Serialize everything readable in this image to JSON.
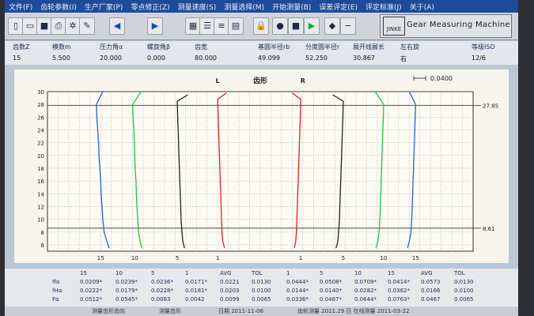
{
  "menu": [
    "文件(F)",
    "齿轮参数(I)",
    "生产厂家(P)",
    "零点修正(Z)",
    "测量速度(S)",
    "测量选择(M)",
    "开始测量(B)",
    "误差评定(E)",
    "评定标准(J)",
    "关于(A)"
  ],
  "toolbar": {
    "icons": [
      "new-file-icon",
      "open-folder-icon",
      "save-icon",
      "print-icon",
      "settings-icon",
      "clear-icon",
      "arrow-left-icon",
      "arrow-right-icon",
      "grid-view-icon",
      "list-view-icon",
      "lines-view-icon",
      "document-icon",
      "lock-icon",
      "record-icon",
      "stop-icon",
      "play-icon",
      "diamond-icon",
      "minus-icon"
    ],
    "brand_text": "Gear Measuring Machine",
    "brand_logo": "JINKE"
  },
  "params": {
    "headers": [
      "齿数Z",
      "模数m",
      "压力角α",
      "螺旋角β",
      "齿宽",
      "基圆半径rb",
      "分度圆半径r",
      "展开线展长",
      "左右旋",
      "等级ISO"
    ],
    "values": [
      "15",
      "5.500",
      "20.000",
      "0.000",
      "80.000",
      "49.099",
      "52.250",
      "30.867",
      "右",
      "12/6"
    ]
  },
  "chart_data": {
    "type": "line",
    "title": "齿形",
    "left_label": "L",
    "right_label": "R",
    "scale_label": "0.0400",
    "y_ticks": [
      30,
      28,
      26,
      24,
      22,
      20,
      18,
      16,
      14,
      12,
      10,
      8,
      6
    ],
    "ylim": [
      5,
      30
    ],
    "xlim": [
      0,
      1
    ],
    "right_markers": [
      "27.85",
      "8.61"
    ],
    "bottom_labels": [
      {
        "text": "15",
        "x": 0.125
      },
      {
        "text": "10",
        "x": 0.205
      },
      {
        "text": "5",
        "x": 0.305
      },
      {
        "text": "1",
        "x": 0.4
      },
      {
        "text": "1",
        "x": 0.595
      },
      {
        "text": "5",
        "x": 0.695
      },
      {
        "text": "10",
        "x": 0.79
      },
      {
        "text": "15",
        "x": 0.865
      }
    ],
    "series": [
      {
        "color": "#2a5fd8",
        "values": [
          [
            0.13,
            30
          ],
          [
            0.115,
            28
          ],
          [
            0.116,
            26
          ],
          [
            0.118,
            24
          ],
          [
            0.12,
            22
          ],
          [
            0.121,
            20
          ],
          [
            0.123,
            18
          ],
          [
            0.125,
            16
          ],
          [
            0.126,
            14
          ],
          [
            0.128,
            12
          ],
          [
            0.13,
            10
          ],
          [
            0.133,
            8
          ],
          [
            0.14,
            6.5
          ],
          [
            0.145,
            5.5
          ]
        ]
      },
      {
        "color": "#22c24a",
        "values": [
          [
            0.22,
            30
          ],
          [
            0.2,
            28
          ],
          [
            0.201,
            26
          ],
          [
            0.203,
            24
          ],
          [
            0.204,
            22
          ],
          [
            0.205,
            20
          ],
          [
            0.206,
            18
          ],
          [
            0.208,
            16
          ],
          [
            0.209,
            14
          ],
          [
            0.21,
            12
          ],
          [
            0.212,
            10
          ],
          [
            0.214,
            8
          ],
          [
            0.218,
            6.5
          ],
          [
            0.222,
            5.5
          ]
        ]
      },
      {
        "color": "#222222",
        "values": [
          [
            0.33,
            29.5
          ],
          [
            0.305,
            28.5
          ],
          [
            0.306,
            26
          ],
          [
            0.307,
            24
          ],
          [
            0.308,
            22
          ],
          [
            0.309,
            20
          ],
          [
            0.31,
            18
          ],
          [
            0.311,
            16
          ],
          [
            0.312,
            14
          ],
          [
            0.313,
            12
          ],
          [
            0.314,
            10
          ],
          [
            0.316,
            8
          ],
          [
            0.318,
            6.5
          ],
          [
            0.322,
            5.5
          ]
        ]
      },
      {
        "color": "#e02020",
        "values": [
          [
            0.42,
            29.8
          ],
          [
            0.4,
            28.8
          ],
          [
            0.401,
            26
          ],
          [
            0.402,
            24
          ],
          [
            0.403,
            22
          ],
          [
            0.404,
            20
          ],
          [
            0.405,
            18
          ],
          [
            0.406,
            16
          ],
          [
            0.407,
            14
          ],
          [
            0.408,
            12
          ],
          [
            0.409,
            10
          ],
          [
            0.41,
            8
          ],
          [
            0.412,
            6.5
          ],
          [
            0.416,
            5.5
          ]
        ]
      },
      {
        "color": "#e02020",
        "values": [
          [
            0.575,
            29.8
          ],
          [
            0.595,
            28.8
          ],
          [
            0.594,
            26
          ],
          [
            0.593,
            24
          ],
          [
            0.592,
            22
          ],
          [
            0.591,
            20
          ],
          [
            0.59,
            18
          ],
          [
            0.589,
            16
          ],
          [
            0.588,
            14
          ],
          [
            0.587,
            12
          ],
          [
            0.586,
            10
          ],
          [
            0.585,
            8
          ],
          [
            0.583,
            6.5
          ],
          [
            0.58,
            5.5
          ]
        ]
      },
      {
        "color": "#222222",
        "values": [
          [
            0.67,
            29.5
          ],
          [
            0.695,
            28.5
          ],
          [
            0.694,
            26
          ],
          [
            0.693,
            24
          ],
          [
            0.692,
            22
          ],
          [
            0.691,
            20
          ],
          [
            0.69,
            18
          ],
          [
            0.689,
            16
          ],
          [
            0.688,
            14
          ],
          [
            0.687,
            12
          ],
          [
            0.686,
            10
          ],
          [
            0.684,
            8
          ],
          [
            0.682,
            6.5
          ],
          [
            0.678,
            5.5
          ]
        ]
      },
      {
        "color": "#22c24a",
        "values": [
          [
            0.77,
            30
          ],
          [
            0.79,
            28
          ],
          [
            0.789,
            26
          ],
          [
            0.788,
            24
          ],
          [
            0.787,
            22
          ],
          [
            0.786,
            20
          ],
          [
            0.785,
            18
          ],
          [
            0.784,
            16
          ],
          [
            0.783,
            14
          ],
          [
            0.782,
            12
          ],
          [
            0.781,
            10
          ],
          [
            0.779,
            8
          ],
          [
            0.776,
            6.5
          ],
          [
            0.772,
            5.5
          ]
        ]
      },
      {
        "color": "#2a5fd8",
        "values": [
          [
            0.85,
            30
          ],
          [
            0.865,
            28
          ],
          [
            0.864,
            26
          ],
          [
            0.863,
            24
          ],
          [
            0.862,
            22
          ],
          [
            0.861,
            20
          ],
          [
            0.86,
            18
          ],
          [
            0.859,
            16
          ],
          [
            0.858,
            14
          ],
          [
            0.857,
            12
          ],
          [
            0.856,
            10
          ],
          [
            0.854,
            8
          ],
          [
            0.85,
            6.5
          ],
          [
            0.846,
            5.5
          ]
        ]
      }
    ]
  },
  "table": {
    "header": [
      "15",
      "10",
      "5",
      "1",
      "AVG",
      "TOL",
      "1",
      "5",
      "10",
      "15",
      "AVG",
      "TOL"
    ],
    "row_labels": [
      "ffα",
      "fHα",
      "Fα"
    ],
    "rows": [
      [
        "0.0209*",
        "0.0239*",
        "0.0236*",
        "0.0171*",
        "0.0221",
        "0.0130",
        "0.0444*",
        "0.0508*",
        "0.0709*",
        "0.0414*",
        "0.0573",
        "0.0130"
      ],
      [
        "0.0222*",
        "0.0179*",
        "0.0228*",
        "0.0181*",
        "0.0203",
        "0.0100",
        "0.0144*",
        "0.0140*",
        "0.0282*",
        "0.0362*",
        "0.0166",
        "0.0100"
      ],
      [
        "0.0512*",
        "0.0545*",
        "0.0083",
        "0.0042",
        "0.0099",
        "0.0065",
        "0.0336*",
        "0.0467*",
        "0.0644*",
        "0.0763*",
        "0.0467",
        "0.0065"
      ]
    ]
  },
  "status": {
    "left": "测量齿形齿向",
    "mid": "测量齿形",
    "date": "日期 2011-11-06",
    "right": "齿轮测量 2011.29 日 在线测量 2011-03-22"
  }
}
